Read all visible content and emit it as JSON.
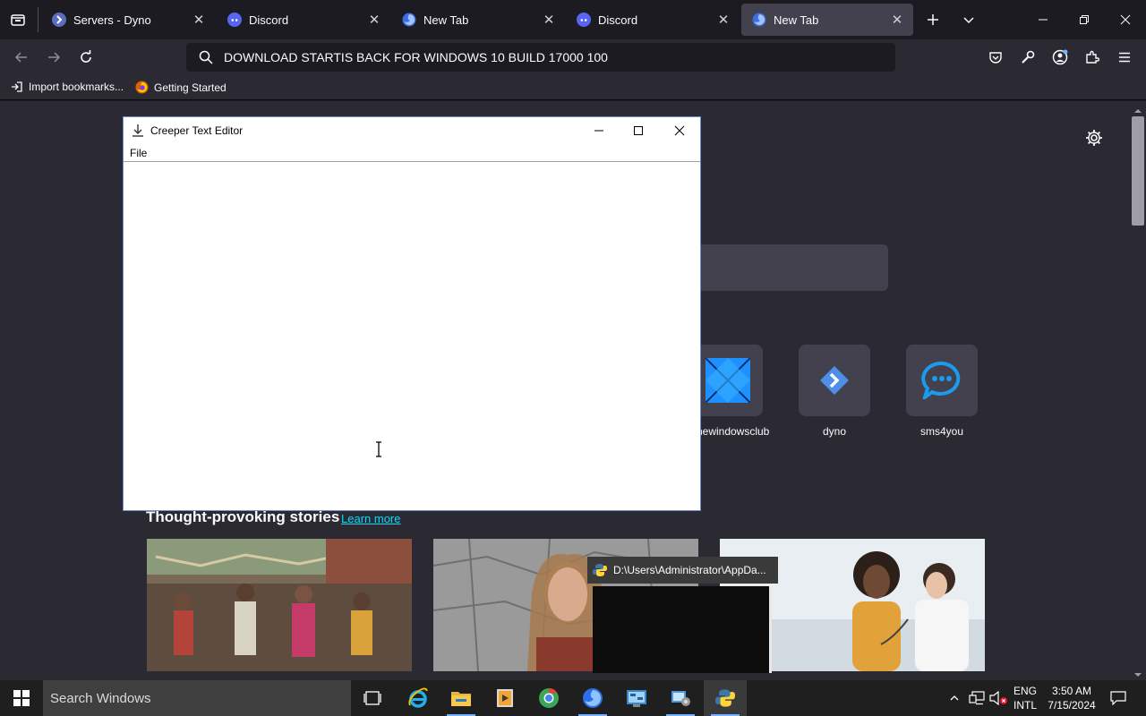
{
  "browser": {
    "tabs": [
      {
        "title": "Servers - Dyno",
        "icon": "dyno-icon",
        "active": false
      },
      {
        "title": "Discord",
        "icon": "discord-icon",
        "active": false
      },
      {
        "title": "New Tab",
        "icon": "firefox-icon",
        "active": false
      },
      {
        "title": "Discord",
        "icon": "discord-icon",
        "active": false
      },
      {
        "title": "New Tab",
        "icon": "firefox-icon",
        "active": true
      }
    ],
    "url_text": "DOWNLOAD STARTIS BACK FOR WINDOWS 10 BUILD 17000 100",
    "bookmarks": [
      {
        "label": "Import bookmarks...",
        "icon": "import-icon"
      },
      {
        "label": "Getting Started",
        "icon": "firefox-icon"
      }
    ]
  },
  "newtab": {
    "shortcuts": [
      {
        "label": "thewindowsclub",
        "icon": "windows-logo-icon"
      },
      {
        "label": "dyno",
        "icon": "dyno-icon"
      },
      {
        "label": "sms4you",
        "icon": "chat-bubble-icon"
      }
    ],
    "stories_heading": "Thought-provoking stories",
    "learn_more": "Learn more"
  },
  "editor": {
    "title": "Creeper Text Editor",
    "menu": [
      "File"
    ],
    "content": ""
  },
  "console": {
    "title": "D:\\Users\\Administrator\\AppDa..."
  },
  "taskbar": {
    "search_placeholder": "Search Windows",
    "lang_primary": "ENG",
    "lang_secondary": "INTL",
    "time": "3:50 AM",
    "date": "7/15/2024"
  },
  "colors": {
    "accent": "#75b2ff",
    "chrome_dark": "#1c1b22",
    "chrome_mid": "#2b2a33",
    "tab_active": "#42414d"
  }
}
